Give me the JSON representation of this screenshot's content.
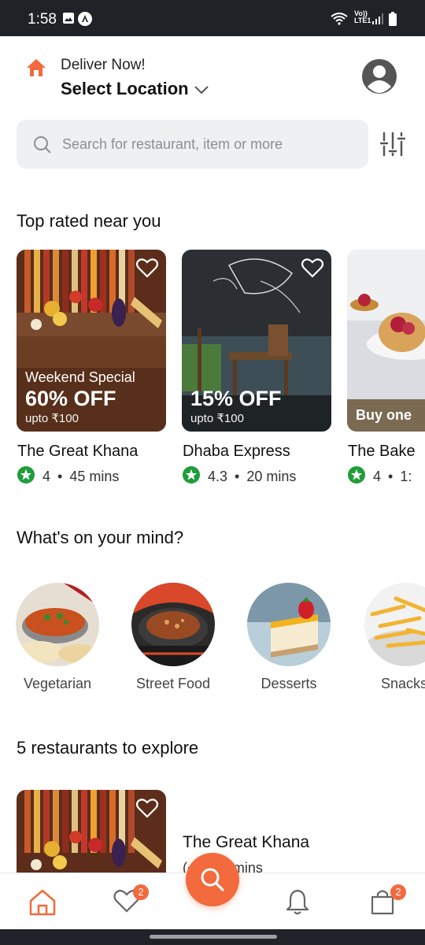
{
  "status_bar": {
    "time": "1:58",
    "network_top": "Vo))",
    "network_bottom": "LTE1"
  },
  "header": {
    "deliver_label": "Deliver Now!",
    "location_label": "Select Location"
  },
  "search": {
    "placeholder": "Search for restaurant, item or more"
  },
  "sections": {
    "top_rated": "Top rated near you",
    "on_your_mind": "What's on your mind?",
    "explore": "5 restaurants to explore"
  },
  "top_rated": [
    {
      "name": "The Great Khana",
      "rating": "4",
      "time": "45 mins",
      "offer_tag": "Weekend Special",
      "offer_main": "60% OFF",
      "offer_sub": "upto ₹100"
    },
    {
      "name": "Dhaba Express",
      "rating": "4.3",
      "time": "20 mins",
      "offer_tag": "",
      "offer_main": "15% OFF",
      "offer_sub": "upto ₹100"
    },
    {
      "name": "The Bake",
      "rating": "4",
      "time": "1:",
      "offer_tag": "",
      "offer_main": "Buy one",
      "offer_sub": ""
    }
  ],
  "categories": [
    {
      "label": "Vegetarian"
    },
    {
      "label": "Street Food"
    },
    {
      "label": "Desserts"
    },
    {
      "label": "Snacks"
    }
  ],
  "explore_card": {
    "name": "The Great Khana",
    "meta": "(+) • 45 mins"
  },
  "bottom_nav": {
    "favorites_badge": "2",
    "cart_badge": "2"
  },
  "colors": {
    "accent": "#f26a3d",
    "rating_green": "#1f9d3a"
  },
  "icons": [
    "home-icon",
    "chevron-down-icon",
    "profile-icon",
    "search-icon",
    "filter-icon",
    "heart-icon",
    "star-icon",
    "bell-icon",
    "bag-icon"
  ]
}
